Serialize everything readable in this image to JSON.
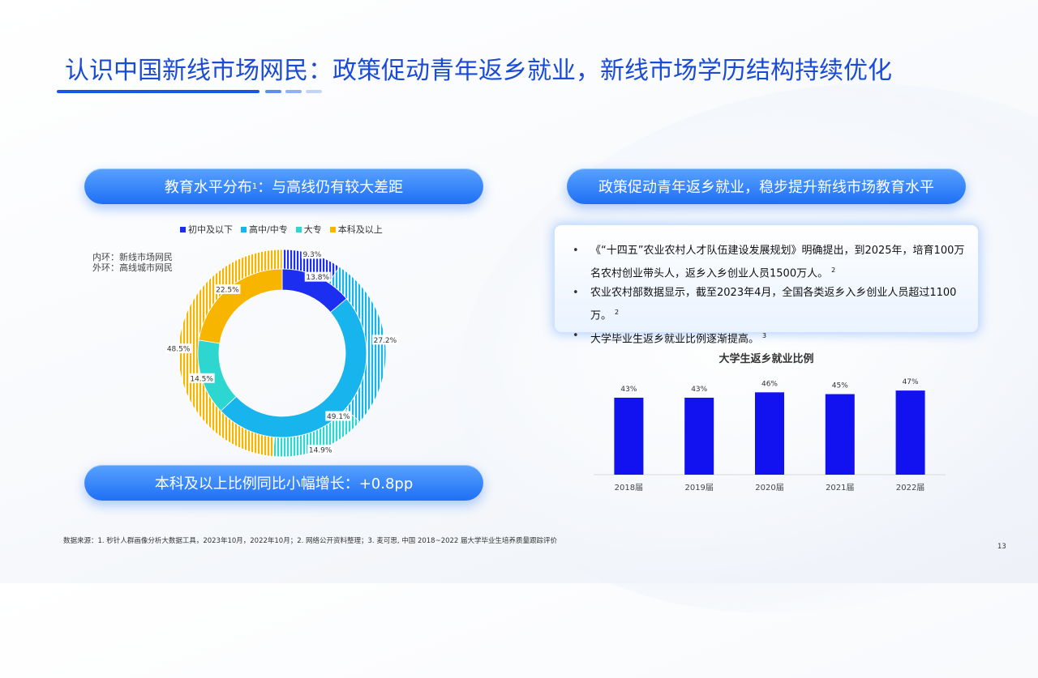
{
  "page": {
    "title": "认识中国新线市场网民：政策促动青年返乡就业，新线市场学历结构持续优化",
    "page_number": "13",
    "source_note": "数据来源：1. 秒针人群画像分析大数据工具，2023年10月，2022年10月；2. 网络公开资料整理；3. 麦可思, 中国 2018~2022 届大学毕业生培养质量跟踪评价"
  },
  "left_panel": {
    "header": "教育水平分布",
    "header_sup": "1",
    "header_rest": "：与高线仍有较大差距",
    "footer": "本科及以上比例同比小幅增长：+0.8pp",
    "inner_note": "内环：新线市场网民",
    "outer_note": "外环：高线城市网民"
  },
  "right_panel": {
    "header": "政策促动青年返乡就业，稳步提升新线市场教育水平",
    "bullets": [
      {
        "text": "《“十四五”农业农村人才队伍建设发展规划》明确提出，到2025年，培育100万名农村创业带头人，返乡入乡创业人员1500万人。",
        "sup": "2"
      },
      {
        "text": "农业农村部数据显示，截至2023年4月，全国各类返乡入乡创业人员超过1100万。",
        "sup": "2"
      },
      {
        "text": "大学毕业生返乡就业比例逐渐提高。",
        "sup": "3"
      }
    ]
  },
  "colors": {
    "accent": "#1a4bd6",
    "dark_blue": "#1c2ff0",
    "sky_blue": "#18b4ee",
    "teal": "#2ed6d0",
    "amber": "#f7b500",
    "bar_blue": "#1212f0"
  },
  "chart_data": [
    {
      "type": "pie",
      "variant": "donut-two-ring",
      "legend_placement": "top",
      "categories": [
        "初中及以下",
        "高中/中专",
        "大专",
        "本科及以上"
      ],
      "series": [
        {
          "name": "内环：新线市场网民",
          "values": [
            13.8,
            49.1,
            14.5,
            22.5
          ],
          "labels": [
            "13.8%",
            "49.1%",
            "14.5%",
            "22.5%"
          ]
        },
        {
          "name": "外环：高线城市网民",
          "values": [
            9.3,
            27.2,
            14.9,
            48.5
          ],
          "labels": [
            "9.3%",
            "27.2%",
            "14.9%",
            "48.5%"
          ]
        }
      ]
    },
    {
      "type": "bar",
      "title": "大学生返乡就业比例",
      "categories": [
        "2018届",
        "2019届",
        "2020届",
        "2021届",
        "2022届"
      ],
      "values": [
        43,
        43,
        46,
        45,
        47
      ],
      "labels": [
        "43%",
        "43%",
        "46%",
        "45%",
        "47%"
      ],
      "ylim": [
        0,
        50
      ],
      "grid": false
    }
  ]
}
